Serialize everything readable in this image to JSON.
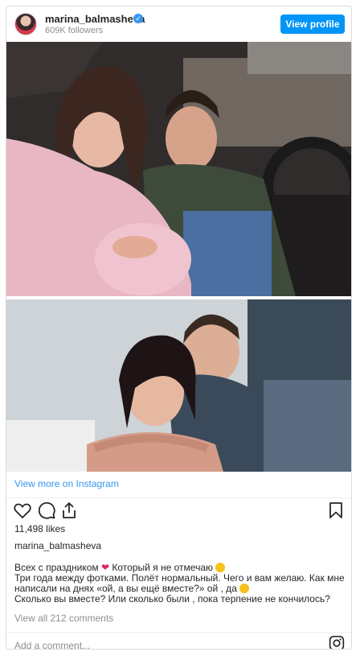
{
  "header": {
    "username": "marina_balmasheva",
    "followers": "609K followers",
    "view_profile_label": "View profile"
  },
  "post": {
    "view_more": "View more on Instagram",
    "likes": "11,498 likes",
    "caption_username": "marina_balmasheva",
    "caption_lines": [
      "Всех с праздником",
      "Который я не отмечаю",
      "Три года между фотками. Полёт нормальный. Чего и вам желаю. Как мне",
      "написали на днях «ой, а вы ещё вместе?» ой , да",
      "Сколько вы вместе? Или сколько были , пока терпение не кончилось?"
    ],
    "view_all_comments": "View all 212 comments",
    "add_comment_placeholder": "Add a comment..."
  },
  "icons": {
    "like": "heart-icon",
    "comment": "comment-icon",
    "share": "share-icon",
    "save": "bookmark-icon",
    "verified": "verified-badge-icon",
    "instagram": "instagram-logo-icon"
  },
  "colors": {
    "accent": "#0095f6",
    "link": "#3897f0",
    "muted": "#8e8e8e",
    "heart_emoji": "#e0245e"
  }
}
